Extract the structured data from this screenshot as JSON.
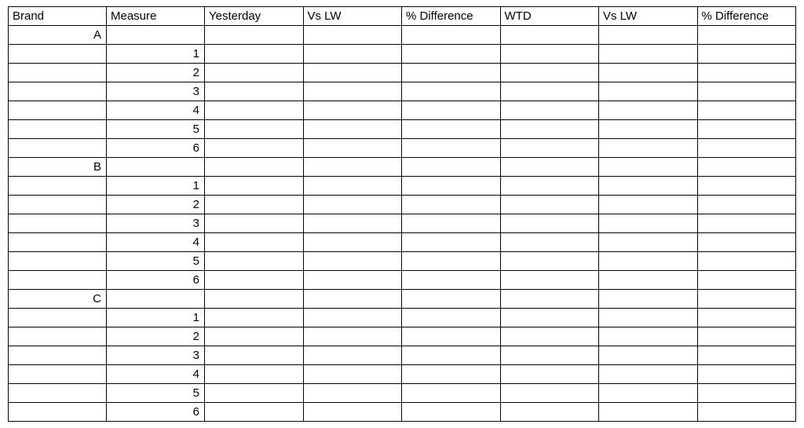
{
  "headers": {
    "brand": "Brand",
    "measure": "Measure",
    "yesterday": "Yesterday",
    "vs_lw_1": "Vs LW",
    "pct_diff_1": "% Difference",
    "wtd": "WTD",
    "vs_lw_2": "Vs LW",
    "pct_diff_2": "% Difference"
  },
  "groups": [
    {
      "brand": "A",
      "measures": [
        "1",
        "2",
        "3",
        "4",
        "5",
        "6"
      ]
    },
    {
      "brand": "B",
      "measures": [
        "1",
        "2",
        "3",
        "4",
        "5",
        "6"
      ]
    },
    {
      "brand": "C",
      "measures": [
        "1",
        "2",
        "3",
        "4",
        "5",
        "6"
      ]
    }
  ]
}
